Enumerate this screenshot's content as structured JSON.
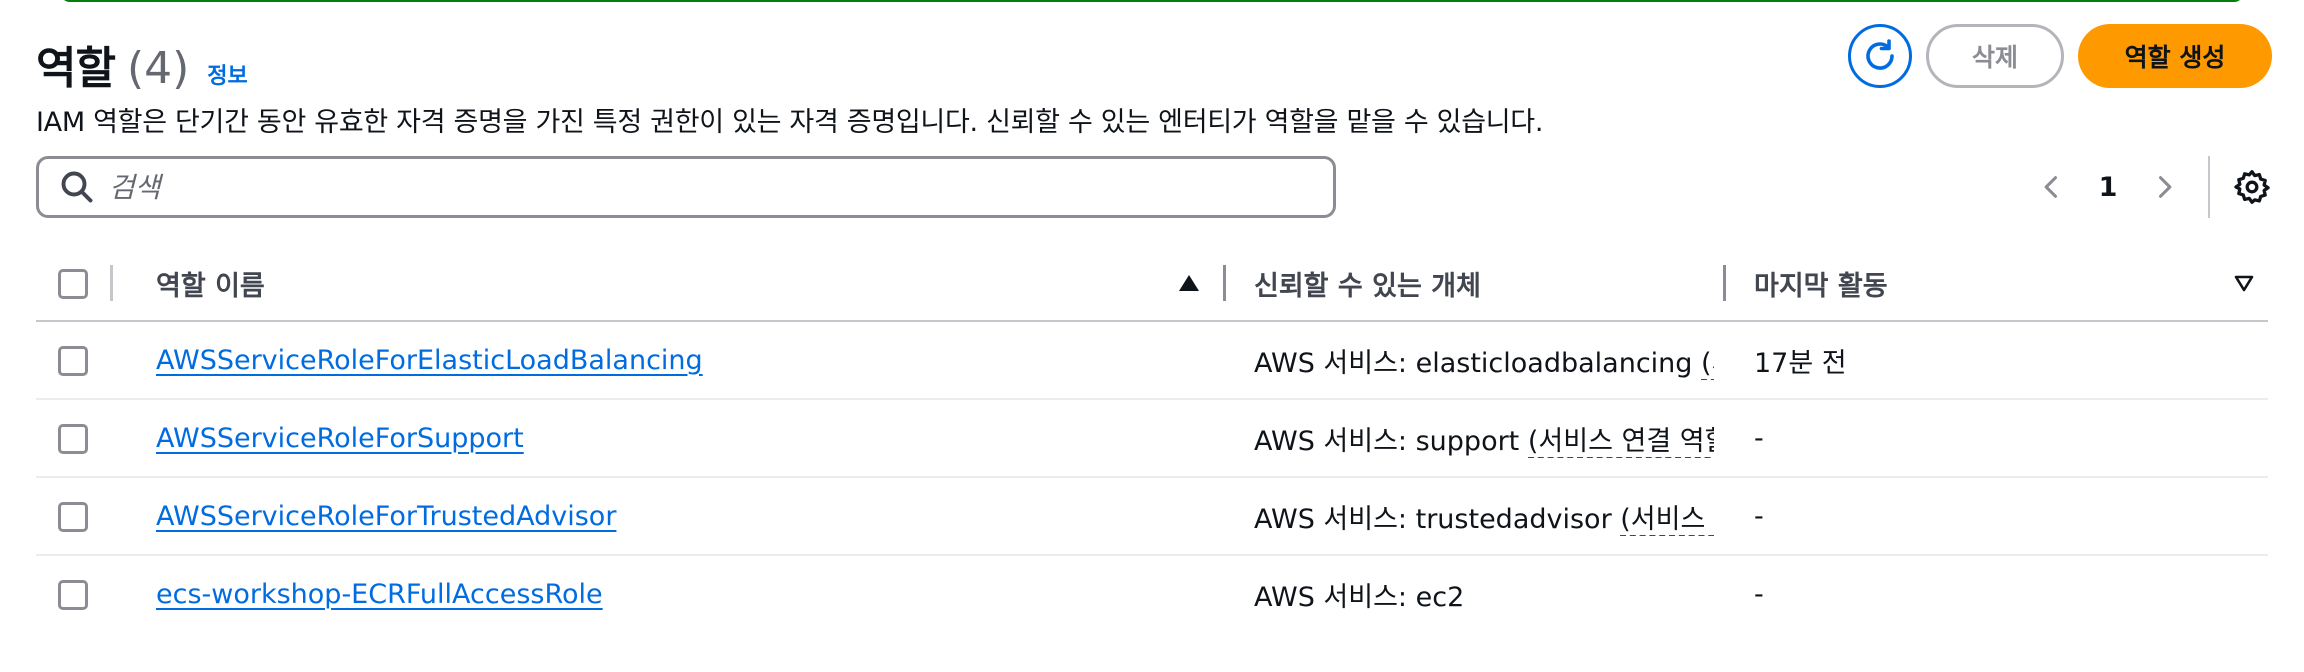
{
  "header": {
    "title": "역할",
    "count": "(4)",
    "info_link": "정보",
    "description": "IAM 역할은 단기간 동안 유효한 자격 증명을 가진 특정 권한이 있는 자격 증명입니다. 신뢰할 수 있는 엔터티가 역할을 맡을 수 있습니다."
  },
  "actions": {
    "refresh_icon": "refresh-icon",
    "delete_label": "삭제",
    "create_label": "역할 생성"
  },
  "search": {
    "placeholder": "검색",
    "value": ""
  },
  "pagination": {
    "current_page": "1"
  },
  "table": {
    "columns": {
      "name": "역할 이름",
      "trusted": "신뢰할 수 있는 개체",
      "last_activity": "마지막 활동"
    },
    "rows": [
      {
        "name": "AWSServiceRoleForElasticLoadBalancing",
        "trusted_prefix": "AWS 서비스: elasticloadbalancing",
        "trusted_suffix": "(서비스 연결 역할)",
        "last_activity": "17분 전"
      },
      {
        "name": "AWSServiceRoleForSupport",
        "trusted_prefix": "AWS 서비스: support",
        "trusted_suffix": "(서비스 연결 역할)",
        "last_activity": "-"
      },
      {
        "name": "AWSServiceRoleForTrustedAdvisor",
        "trusted_prefix": "AWS 서비스: trustedadvisor",
        "trusted_suffix": "(서비스 연결 역할)",
        "last_activity": "-"
      },
      {
        "name": "ecs-workshop-ECRFullAccessRole",
        "trusted_prefix": "AWS 서비스: ec2",
        "trusted_suffix": "",
        "last_activity": "-"
      }
    ]
  },
  "colors": {
    "link": "#006ce0",
    "primary_button": "#ff9900",
    "flash_border": "#037f0c"
  }
}
